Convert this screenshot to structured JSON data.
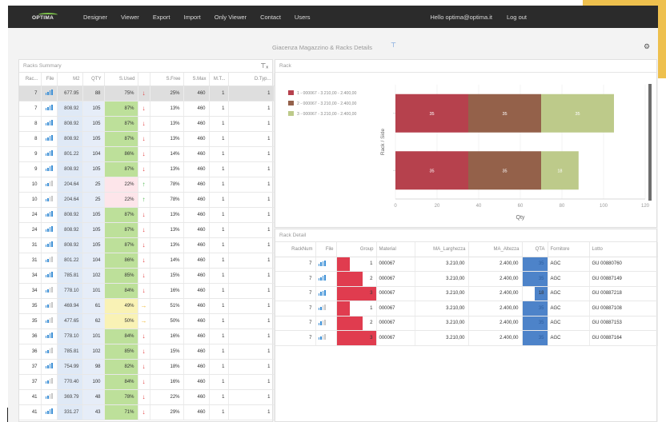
{
  "nav": {
    "logo": "OPTIMA",
    "items": [
      "Designer",
      "Viewer",
      "Export",
      "Import",
      "Only Viewer",
      "Contact",
      "Users"
    ],
    "user": "Hello optima@optima.it",
    "logout": "Log out"
  },
  "page": {
    "title": "Giacenza Magazzino & Racks Details",
    "filter_icon": "filter-icon",
    "tool_icon": "settings-icon"
  },
  "summary": {
    "title": "Racks Summary",
    "columns": [
      "Rac...",
      "File",
      "M2",
      "QTY",
      "S.Used",
      "",
      "S.Free",
      "S.Max",
      "M.T...",
      "D.Typ..."
    ],
    "rows": [
      {
        "rack": "7",
        "sig": 4,
        "m2": "677.95",
        "qty": "88",
        "used": "75%",
        "u": 75,
        "arrow": "down",
        "free": "25%",
        "max": "460",
        "mt": "1",
        "dt": "1",
        "sel": true
      },
      {
        "rack": "7",
        "sig": 4,
        "m2": "808.92",
        "qty": "105",
        "used": "87%",
        "u": 87,
        "arrow": "down",
        "free": "13%",
        "max": "460",
        "mt": "1",
        "dt": "1"
      },
      {
        "rack": "8",
        "sig": 4,
        "m2": "808.92",
        "qty": "105",
        "used": "87%",
        "u": 87,
        "arrow": "down",
        "free": "13%",
        "max": "460",
        "mt": "1",
        "dt": "1"
      },
      {
        "rack": "8",
        "sig": 4,
        "m2": "808.92",
        "qty": "105",
        "used": "87%",
        "u": 87,
        "arrow": "down",
        "free": "13%",
        "max": "460",
        "mt": "1",
        "dt": "1"
      },
      {
        "rack": "9",
        "sig": 4,
        "m2": "801.22",
        "qty": "104",
        "used": "86%",
        "u": 86,
        "arrow": "down",
        "free": "14%",
        "max": "460",
        "mt": "1",
        "dt": "1"
      },
      {
        "rack": "9",
        "sig": 4,
        "m2": "808.92",
        "qty": "105",
        "used": "87%",
        "u": 87,
        "arrow": "down",
        "free": "13%",
        "max": "460",
        "mt": "1",
        "dt": "1"
      },
      {
        "rack": "10",
        "sig": 2,
        "m2": "204.64",
        "qty": "25",
        "used": "22%",
        "u": 22,
        "arrow": "up",
        "free": "78%",
        "max": "460",
        "mt": "1",
        "dt": "1"
      },
      {
        "rack": "10",
        "sig": 2,
        "m2": "204.64",
        "qty": "25",
        "used": "22%",
        "u": 22,
        "arrow": "up",
        "free": "78%",
        "max": "460",
        "mt": "1",
        "dt": "1"
      },
      {
        "rack": "24",
        "sig": 4,
        "m2": "808.92",
        "qty": "105",
        "used": "87%",
        "u": 87,
        "arrow": "down",
        "free": "13%",
        "max": "460",
        "mt": "1",
        "dt": "1"
      },
      {
        "rack": "24",
        "sig": 4,
        "m2": "808.92",
        "qty": "105",
        "used": "87%",
        "u": 87,
        "arrow": "down",
        "free": "13%",
        "max": "460",
        "mt": "1",
        "dt": "1"
      },
      {
        "rack": "31",
        "sig": 4,
        "m2": "808.92",
        "qty": "105",
        "used": "87%",
        "u": 87,
        "arrow": "down",
        "free": "13%",
        "max": "460",
        "mt": "1",
        "dt": "1"
      },
      {
        "rack": "31",
        "sig": 2,
        "m2": "801.22",
        "qty": "104",
        "used": "86%",
        "u": 86,
        "arrow": "down",
        "free": "14%",
        "max": "460",
        "mt": "1",
        "dt": "1"
      },
      {
        "rack": "34",
        "sig": 4,
        "m2": "785.81",
        "qty": "102",
        "used": "85%",
        "u": 85,
        "arrow": "down",
        "free": "15%",
        "max": "460",
        "mt": "1",
        "dt": "1"
      },
      {
        "rack": "34",
        "sig": 2,
        "m2": "778.10",
        "qty": "101",
        "used": "84%",
        "u": 84,
        "arrow": "down",
        "free": "16%",
        "max": "460",
        "mt": "1",
        "dt": "1"
      },
      {
        "rack": "35",
        "sig": 2,
        "m2": "469.94",
        "qty": "61",
        "used": "49%",
        "u": 49,
        "arrow": "right",
        "free": "51%",
        "max": "460",
        "mt": "1",
        "dt": "1"
      },
      {
        "rack": "35",
        "sig": 2,
        "m2": "477.65",
        "qty": "62",
        "used": "50%",
        "u": 50,
        "arrow": "right",
        "free": "50%",
        "max": "460",
        "mt": "1",
        "dt": "1"
      },
      {
        "rack": "36",
        "sig": 4,
        "m2": "778.10",
        "qty": "101",
        "used": "84%",
        "u": 84,
        "arrow": "down",
        "free": "16%",
        "max": "460",
        "mt": "1",
        "dt": "1"
      },
      {
        "rack": "36",
        "sig": 2,
        "m2": "785.81",
        "qty": "102",
        "used": "85%",
        "u": 85,
        "arrow": "down",
        "free": "15%",
        "max": "460",
        "mt": "1",
        "dt": "1"
      },
      {
        "rack": "37",
        "sig": 4,
        "m2": "754.99",
        "qty": "98",
        "used": "82%",
        "u": 82,
        "arrow": "down",
        "free": "18%",
        "max": "460",
        "mt": "1",
        "dt": "1"
      },
      {
        "rack": "37",
        "sig": 2,
        "m2": "770.40",
        "qty": "100",
        "used": "84%",
        "u": 84,
        "arrow": "down",
        "free": "16%",
        "max": "460",
        "mt": "1",
        "dt": "1"
      },
      {
        "rack": "41",
        "sig": 2,
        "m2": "369.79",
        "qty": "48",
        "used": "78%",
        "u": 78,
        "arrow": "down",
        "free": "22%",
        "max": "460",
        "mt": "1",
        "dt": "1"
      },
      {
        "rack": "41",
        "sig": 4,
        "m2": "331.27",
        "qty": "43",
        "used": "71%",
        "u": 71,
        "arrow": "down",
        "free": "29%",
        "max": "460",
        "mt": "1",
        "dt": "1"
      }
    ]
  },
  "rack": {
    "title": "Rack"
  },
  "chart_data": {
    "type": "bar",
    "orientation": "horizontal",
    "stacked": true,
    "title": "",
    "xlabel": "Qty",
    "ylabel": "Rack / Side",
    "categories": [
      "",
      ""
    ],
    "xlim": [
      0,
      120
    ],
    "xticks": [
      0,
      20,
      40,
      60,
      80,
      100,
      120
    ],
    "series": [
      {
        "name": "1 - 000067 - 3.210,00 - 2.400,00",
        "color": "#b6414d",
        "values": [
          35,
          35
        ]
      },
      {
        "name": "2 - 000067 - 3.210,00 - 2.400,00",
        "color": "#94614a",
        "values": [
          35,
          35
        ]
      },
      {
        "name": "3 - 000067 - 3.210,00 - 2.400,00",
        "color": "#bdca8a",
        "values": [
          35,
          18
        ]
      }
    ],
    "legend": "top-left",
    "grid": true
  },
  "detail": {
    "title": "Rack Detail",
    "columns": [
      "RackNum",
      "File",
      "Group",
      "Material",
      "MA_Larghezza",
      "MA_Altezza",
      "QTA",
      "Fornitore",
      "Lotto"
    ],
    "rows": [
      {
        "rack": "7",
        "sig": 4,
        "group": "1",
        "g": 1,
        "material": "000067",
        "larg": "3.210,00",
        "alt": "2.400,00",
        "qta": "35",
        "q": 35,
        "forn": "AGC",
        "lotto": "GU 00880760"
      },
      {
        "rack": "7",
        "sig": 4,
        "group": "2",
        "g": 2,
        "material": "000067",
        "larg": "3.210,00",
        "alt": "2.400,00",
        "qta": "35",
        "q": 35,
        "forn": "AGC",
        "lotto": "GU 00887149"
      },
      {
        "rack": "7",
        "sig": 4,
        "group": "3",
        "g": 3,
        "material": "000067",
        "larg": "3.210,00",
        "alt": "2.400,00",
        "qta": "18",
        "q": 18,
        "forn": "AGC",
        "lotto": "GU 00887218"
      },
      {
        "rack": "7",
        "sig": 2,
        "group": "1",
        "g": 1,
        "material": "000067",
        "larg": "3.210,00",
        "alt": "2.400,00",
        "qta": "35",
        "q": 35,
        "forn": "AGC",
        "lotto": "GU 00887108"
      },
      {
        "rack": "7",
        "sig": 2,
        "group": "2",
        "g": 2,
        "material": "000067",
        "larg": "3.210,00",
        "alt": "2.400,00",
        "qta": "35",
        "q": 35,
        "forn": "AGC",
        "lotto": "GU 00887153"
      },
      {
        "rack": "7",
        "sig": 2,
        "group": "3",
        "g": 3,
        "material": "000067",
        "larg": "3.210,00",
        "alt": "2.400,00",
        "qta": "35",
        "q": 35,
        "forn": "AGC",
        "lotto": "GU 00887164"
      }
    ]
  }
}
